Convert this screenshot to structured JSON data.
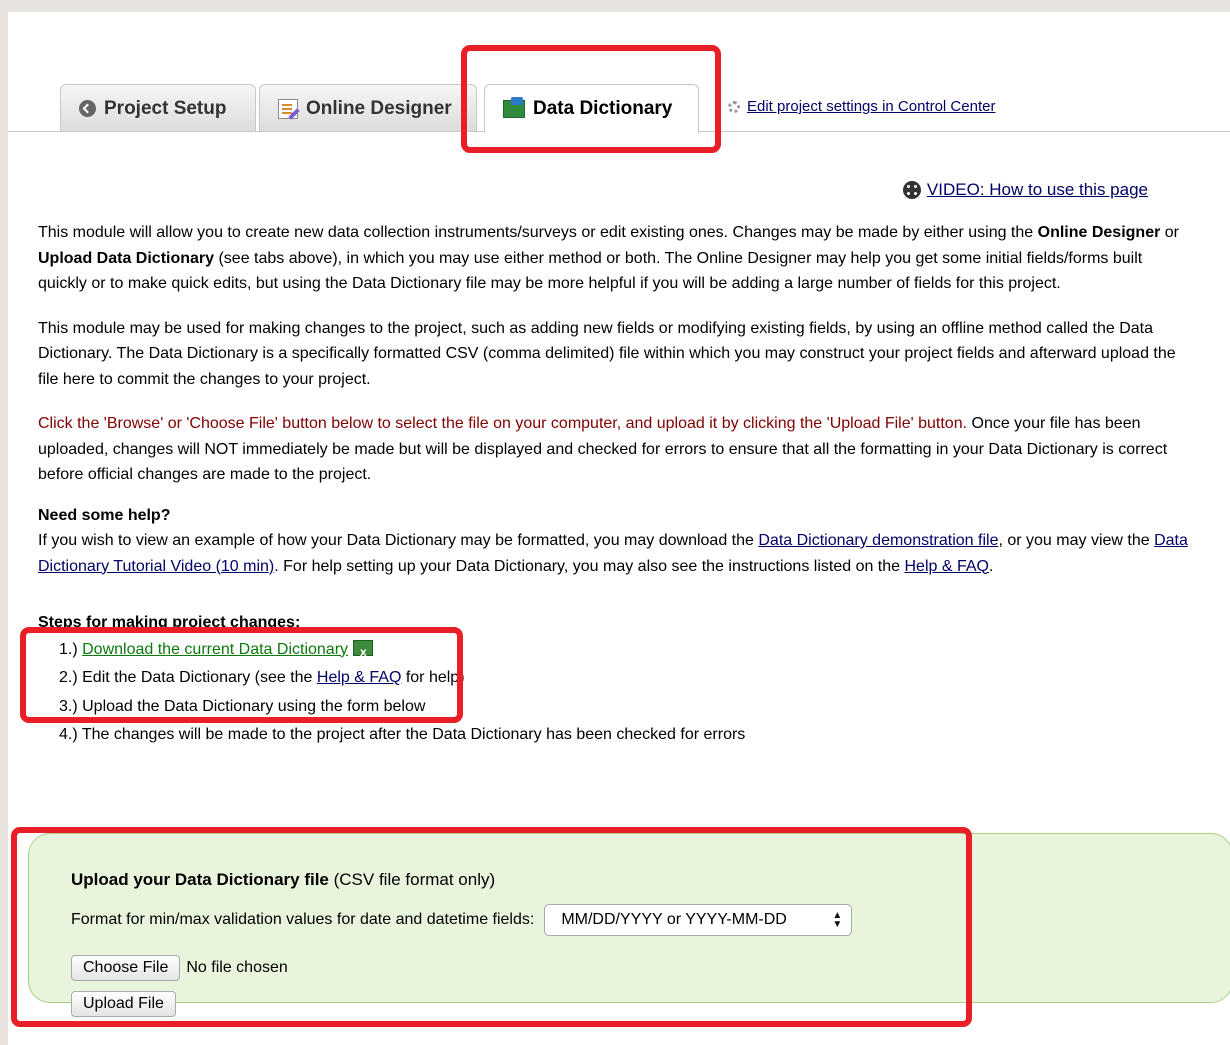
{
  "tabs": [
    {
      "label": "Project Setup",
      "icon": "back-circle-icon"
    },
    {
      "label": "Online Designer",
      "icon": "designer-icon"
    },
    {
      "label": "Data Dictionary",
      "icon": "data-dictionary-icon",
      "active": true
    }
  ],
  "settings_link": "Edit project settings in Control Center",
  "video_link": "VIDEO: How to use this page",
  "intro": {
    "p1_a": "This module will allow you to create new data collection instruments/surveys or edit existing ones. Changes may be made by either using the ",
    "p1_b": "Online Designer",
    "p1_c": " or ",
    "p1_d": "Upload Data Dictionary",
    "p1_e": " (see tabs above), in which you may use either method or both. The Online Designer may help you get some initial fields/forms built quickly or to make quick edits, but using the Data Dictionary file may be more helpful if you will be adding a large number of fields for this project.",
    "p2": "This module may be used for making changes to the project, such as adding new fields or modifying existing fields, by using an offline method called the Data Dictionary. The Data Dictionary is a specifically formatted CSV (comma delimited) file within which you may construct your project fields and afterward upload the file here to commit the changes to your project.",
    "p3_a": "Click the 'Browse' or 'Choose File' button below to select the file on your computer, and upload it by clicking the 'Upload File' button.",
    "p3_b": " Once your file has been uploaded, changes will NOT immediately be made but will be displayed and checked for errors to ensure that all the formatting in your Data Dictionary is correct before official changes are made to the project."
  },
  "help": {
    "heading": "Need some help?",
    "t1": "If you wish to view an example of how your Data Dictionary may be formatted, you may download the ",
    "link1": "Data Dictionary demonstration file",
    "t2": ", or you may view the ",
    "link2": "Data Dictionary Tutorial Video (10 min)",
    "t3": ". For help setting up your Data Dictionary, you may also see the instructions listed on the ",
    "link3": "Help & FAQ",
    "t4": "."
  },
  "steps": {
    "heading": "Steps for making project changes:",
    "s1_num": "1.) ",
    "s1_link": "Download the current Data Dictionary",
    "s2_a": "2.) Edit the Data Dictionary (see the ",
    "s2_link": "Help & FAQ",
    "s2_b": " for help)",
    "s3": "3.) Upload the Data Dictionary using the form below",
    "s4": "4.) The changes will be made to the project after the Data Dictionary has been checked for errors"
  },
  "upload": {
    "title_bold": "Upload your Data Dictionary file",
    "title_rest": " (CSV file format only)",
    "format_label": "Format for min/max validation values for date and datetime fields:",
    "format_value": "MM/DD/YYYY or YYYY-MM-DD",
    "choose_label": "Choose File",
    "no_file": "No file chosen",
    "upload_label": "Upload File"
  },
  "colors": {
    "highlight": "#e81f26",
    "upload_bg": "#e8f5dc",
    "link": "#000066"
  }
}
